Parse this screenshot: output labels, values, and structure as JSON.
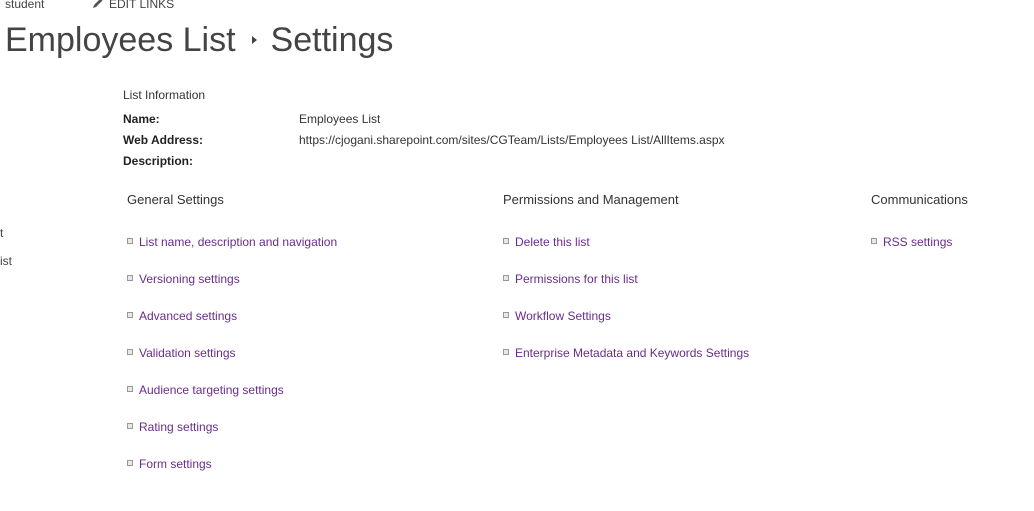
{
  "top": {
    "crumb_prev": "student",
    "edit_links": "EDIT LINKS"
  },
  "title": {
    "list_name": "Employees List",
    "page": "Settings"
  },
  "left_nav_fragments": [
    "t",
    "ist"
  ],
  "list_info": {
    "heading": "List Information",
    "name_label": "Name:",
    "name_value": "Employees List",
    "address_label": "Web Address:",
    "address_value": "https://cjogani.sharepoint.com/sites/CGTeam/Lists/Employees List/AllItems.aspx",
    "description_label": "Description:",
    "description_value": ""
  },
  "general": {
    "heading": "General Settings",
    "items": [
      "List name, description and navigation",
      "Versioning settings",
      "Advanced settings",
      "Validation settings",
      "Audience targeting settings",
      "Rating settings",
      "Form settings"
    ]
  },
  "permissions": {
    "heading": "Permissions and Management",
    "items": [
      "Delete this list",
      "Permissions for this list",
      "Workflow Settings",
      "Enterprise Metadata and Keywords Settings"
    ]
  },
  "communications": {
    "heading": "Communications",
    "items": [
      "RSS settings"
    ]
  },
  "colors": {
    "link": "#6a2c8a",
    "text": "#333333"
  }
}
